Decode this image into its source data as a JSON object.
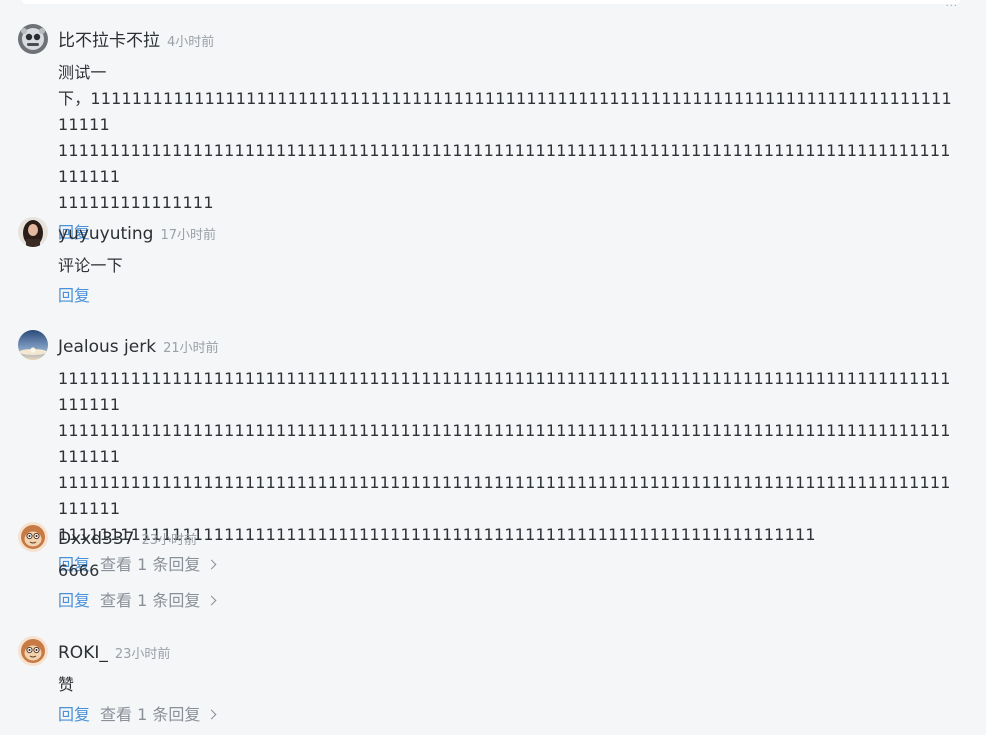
{
  "top": {
    "dots": "..."
  },
  "comments": [
    {
      "username": "比不拉卡不拉",
      "time": "4小时前",
      "avatar_icon": "robot-avatar-icon",
      "lines": [
        "测试一",
        "下，1111111111111111111111111111111111111111111111111111111111111111111111111111111111111111",
        "11111111111111111111111111111111111111111111111111111111111111111111111111111111111111111111",
        "111111111111111"
      ],
      "reply_label": "回复",
      "view_replies": ""
    },
    {
      "username": "yuyuyuting",
      "time": "17小时前",
      "avatar_icon": "portrait-avatar-icon",
      "lines": [
        "评论一下"
      ],
      "reply_label": "回复",
      "view_replies": ""
    },
    {
      "username": "Jealous jerk",
      "time": "21小时前",
      "avatar_icon": "sky-avatar-icon",
      "lines": [
        "11111111111111111111111111111111111111111111111111111111111111111111111111111111111111111111",
        "11111111111111111111111111111111111111111111111111111111111111111111111111111111111111111111",
        "11111111111111111111111111111111111111111111111111111111111111111111111111111111111111111111",
        "1111111111111111111111111111111111111111111111111111111111111111111111111"
      ],
      "reply_label": "回复",
      "view_replies": "查看 1 条回复"
    },
    {
      "username": "Dxxd337",
      "time": "23小时前",
      "avatar_icon": "monkey-avatar-icon",
      "lines": [
        "6666"
      ],
      "reply_label": "回复",
      "view_replies": "查看 1 条回复"
    },
    {
      "username": "ROKI_",
      "time": "23小时前",
      "avatar_icon": "monkey-avatar-icon",
      "lines": [
        "赞"
      ],
      "reply_label": "回复",
      "view_replies": "查看 1 条回复"
    }
  ]
}
